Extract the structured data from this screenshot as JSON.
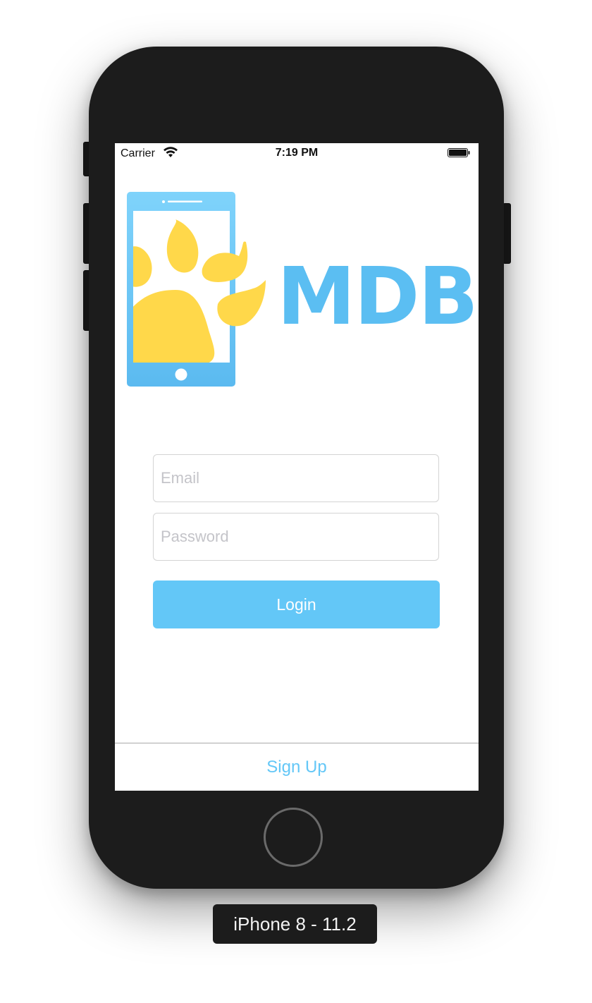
{
  "status_bar": {
    "carrier": "Carrier",
    "time": "7:19 PM",
    "wifi_icon": "wifi-icon",
    "battery_icon": "battery-icon"
  },
  "logo": {
    "text": "MDB",
    "icon": "phone-paw-icon",
    "colors": {
      "blue": "#5bbef2",
      "yellow": "#ffd84a"
    }
  },
  "login_form": {
    "email_placeholder": "Email",
    "email_value": "",
    "password_placeholder": "Password",
    "password_value": "",
    "login_label": "Login"
  },
  "bottom_bar": {
    "signup_label": "Sign Up"
  },
  "simulator": {
    "device_label": "iPhone 8 - 11.2"
  },
  "colors": {
    "accent": "#63c7f7",
    "device_body": "#1c1c1c"
  }
}
